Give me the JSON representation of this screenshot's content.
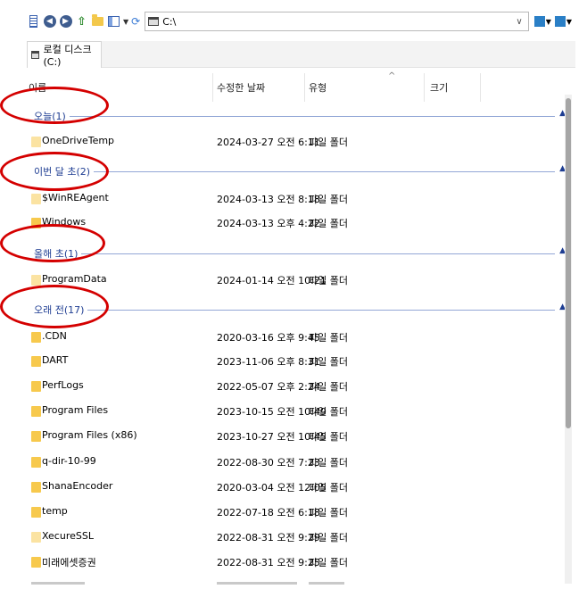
{
  "toolbar": {
    "icons": [
      "list-view-icon",
      "back-icon",
      "forward-icon",
      "up-icon",
      "new-folder-icon",
      "view-mode-icon",
      "refresh-icon"
    ],
    "address": "C:\\"
  },
  "breadcrumb": {
    "label": "로컬 디스크 (C:)"
  },
  "columns": {
    "name": "이름",
    "date": "수정한 날짜",
    "type": "유형",
    "size": "크기"
  },
  "groups": [
    {
      "label": "오늘(1)",
      "items": [
        {
          "name": "OneDriveTemp",
          "date": "2024-03-27 오전 6:11",
          "type": "파일 폴더"
        }
      ]
    },
    {
      "label": "이번 달 초(2)",
      "items": [
        {
          "name": "$WinREAgent",
          "date": "2024-03-13 오전 8:18",
          "type": "파일 폴더"
        },
        {
          "name": "Windows",
          "date": "2024-03-13 오후 4:22",
          "type": "파일 폴더"
        }
      ]
    },
    {
      "label": "올해 초(1)",
      "items": [
        {
          "name": "ProgramData",
          "date": "2024-01-14 오전 10:21",
          "type": "파일 폴더"
        }
      ]
    },
    {
      "label": "오래 전(17)",
      "items": [
        {
          "name": ".CDN",
          "date": "2020-03-16 오후 9:45",
          "type": "파일 폴더"
        },
        {
          "name": "DART",
          "date": "2023-11-06 오후 8:31",
          "type": "파일 폴더"
        },
        {
          "name": "PerfLogs",
          "date": "2022-05-07 오후 2:24",
          "type": "파일 폴더"
        },
        {
          "name": "Program Files",
          "date": "2023-10-15 오전 10:49",
          "type": "파일 폴더"
        },
        {
          "name": "Program Files (x86)",
          "date": "2023-10-27 오전 10:45",
          "type": "파일 폴더"
        },
        {
          "name": "q-dir-10-99",
          "date": "2022-08-30 오전 7:23",
          "type": "파일 폴더"
        },
        {
          "name": "ShanaEncoder",
          "date": "2020-03-04 오전 12:05",
          "type": "파일 폴더"
        },
        {
          "name": "temp",
          "date": "2022-07-18 오전 6:18",
          "type": "파일 폴더"
        },
        {
          "name": "XecureSSL",
          "date": "2022-08-31 오전 9:29",
          "type": "파일 폴더"
        },
        {
          "name": "미래에셋증권",
          "date": "2022-08-31 오전 9:25",
          "type": "파일 폴더"
        }
      ]
    }
  ],
  "colors": {
    "group_text": "#1e3d92",
    "annotation": "#d40000",
    "folder": "#f7c94d"
  }
}
